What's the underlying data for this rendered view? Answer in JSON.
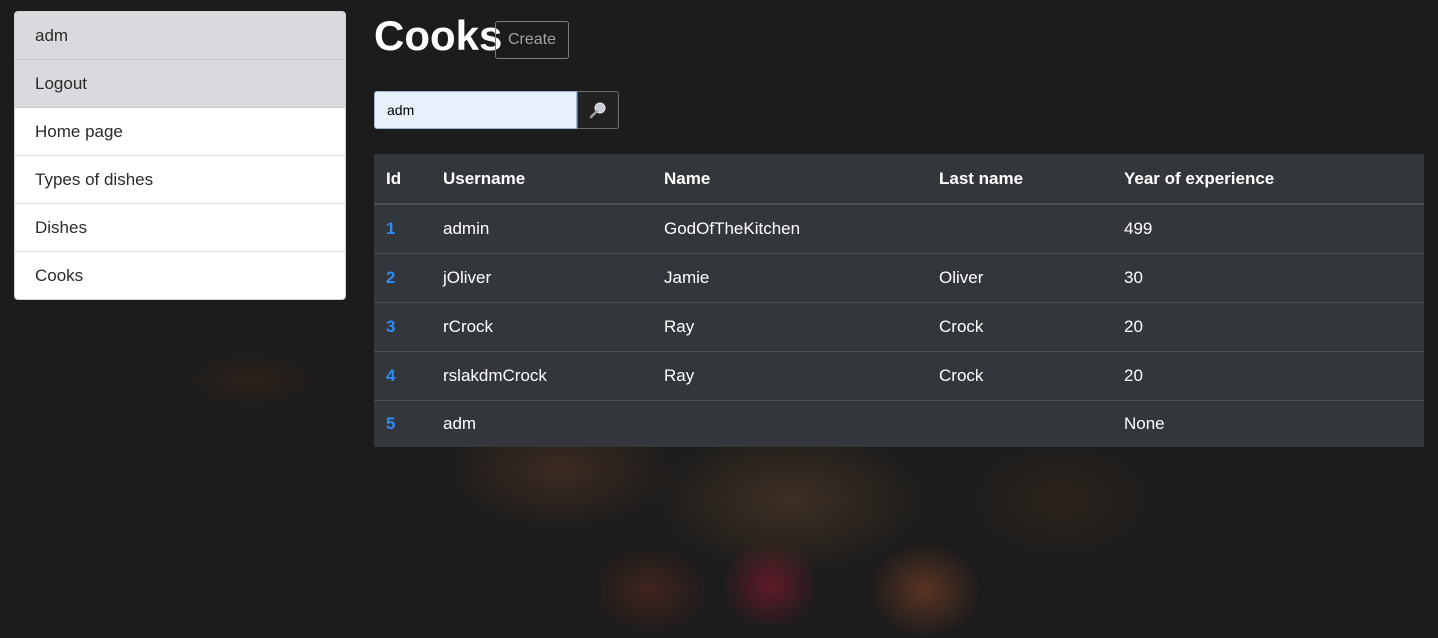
{
  "menu": {
    "items": [
      {
        "label": "adm"
      },
      {
        "label": "Logout"
      },
      {
        "label": "Home page"
      },
      {
        "label": "Types of dishes"
      },
      {
        "label": "Dishes"
      },
      {
        "label": "Cooks"
      }
    ]
  },
  "page": {
    "title": "Cooks",
    "create_label": "Create"
  },
  "search": {
    "value": "adm",
    "button_icon": "search-icon"
  },
  "table": {
    "columns": [
      "Id",
      "Username",
      "Name",
      "Last name",
      "Year of experience"
    ],
    "rows": [
      {
        "id": "1",
        "username": "admin",
        "name": "GodOfTheKitchen",
        "last_name": "",
        "experience": "499"
      },
      {
        "id": "2",
        "username": "jOliver",
        "name": "Jamie",
        "last_name": "Oliver",
        "experience": "30"
      },
      {
        "id": "3",
        "username": "rCrock",
        "name": "Ray",
        "last_name": "Crock",
        "experience": "20"
      },
      {
        "id": "4",
        "username": "rslakdmCrock",
        "name": "Ray",
        "last_name": "Crock",
        "experience": "20"
      },
      {
        "id": "5",
        "username": "adm",
        "name": "",
        "last_name": "",
        "experience": "None"
      }
    ]
  },
  "colors": {
    "accent": "#2f8bf5",
    "table_bg": "#33373c",
    "page_bg": "#1c1c1c"
  }
}
